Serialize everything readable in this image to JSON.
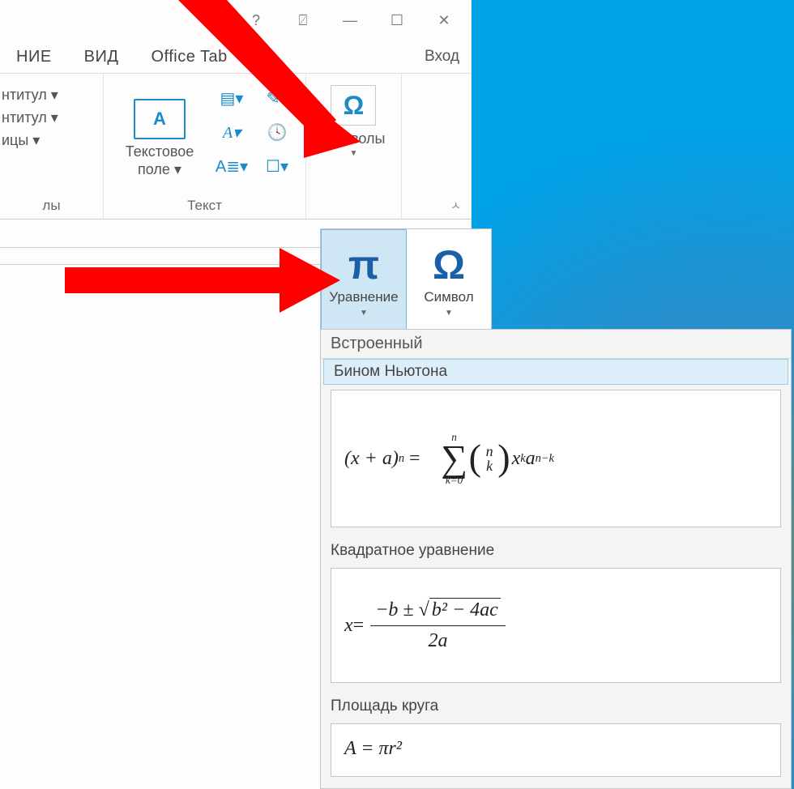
{
  "titlebar": {
    "help": "?",
    "options_icon": "⍁",
    "minimize": "—",
    "maximize": "☐",
    "close": "✕"
  },
  "tabs": {
    "t1": "НИЕ",
    "t2": "ВИД",
    "t3": "Office Tab",
    "login": "Вход"
  },
  "ribbon": {
    "group1": {
      "item1": "нтитул ▾",
      "item2": "нтитул ▾",
      "item3": "ицы ▾",
      "label": "лы"
    },
    "group2": {
      "textbox": "Текстовое\nполе ▾",
      "label": "Текст"
    },
    "group3": {
      "symbols": "Символы"
    }
  },
  "symbols_drop": {
    "equation": "Уравнение",
    "symbol": "Символ"
  },
  "gallery": {
    "header": "Встроенный",
    "sec1": "Бином Ньютона",
    "sec2": "Квадратное уравнение",
    "sec3": "Площадь круга",
    "binom": {
      "left_a": "(x + a)",
      "exp_n": "n",
      "sum_top": "n",
      "sum_bot": "k=0",
      "binom_top": "n",
      "binom_bot": "k",
      "xk": "x",
      "xk_exp": "k",
      "an": "a",
      "an_exp": "n−k"
    },
    "quad": {
      "x": "x",
      "eq": " = ",
      "num_pre": "−b ± ",
      "sqrt_body": "b² − 4ac",
      "den": "2a"
    },
    "circle": {
      "partial": "A = πr²"
    }
  }
}
